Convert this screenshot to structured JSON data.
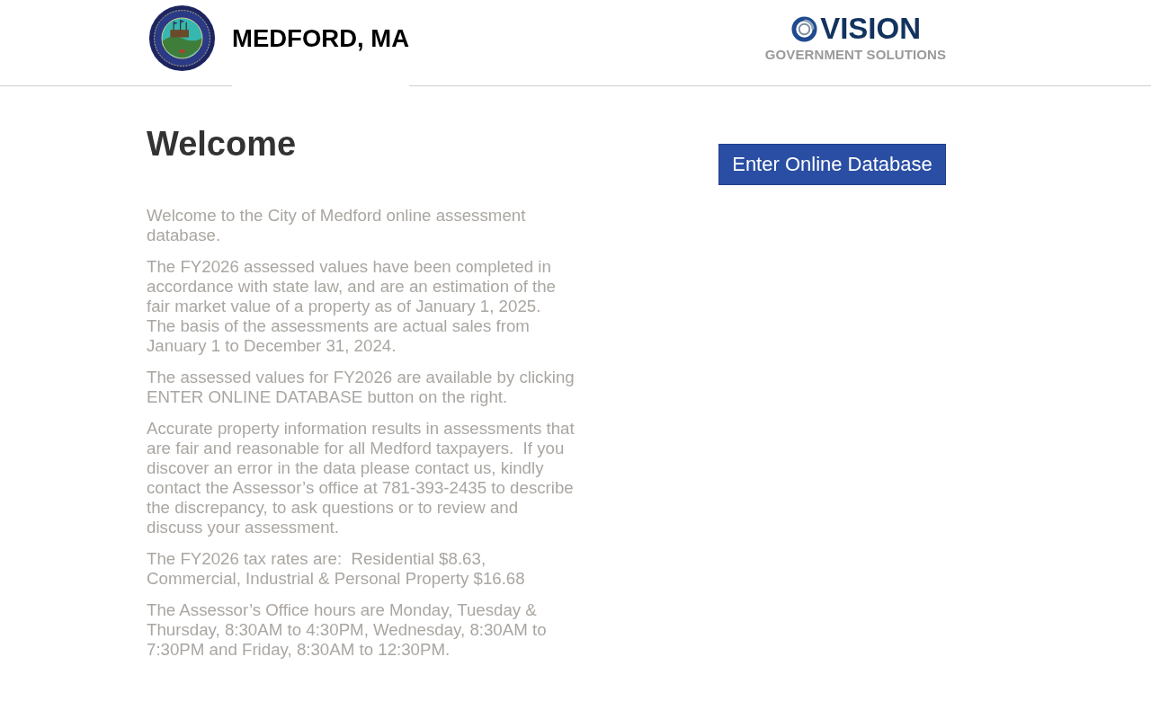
{
  "header": {
    "city_title": "MEDFORD, MA",
    "vendor_logo": {
      "wordmark": "VISION",
      "tagline": "GOVERNMENT SOLUTIONS"
    }
  },
  "welcome": {
    "title": "Welcome",
    "paragraphs": [
      "Welcome to the City of Medford online assessment database.",
      "The FY2026 assessed values have been completed in accordance with state law, and are an estimation of the fair market value of a property as of January 1, 2025.  The basis of the assessments are actual sales from January 1 to December 31, 2024.",
      "The assessed values for FY2026 are available by clicking ENTER ONLINE DATABASE button on the right.",
      "Accurate property information results in assessments that are fair and reasonable for all Medford taxpayers.  If you discover an error in the data please contact us, kindly contact the Assessor’s office at 781-393-2435 to describe the discrepancy, to ask questions or to review and discuss your assessment.",
      "The FY2026 tax rates are:  Residential $8.63, Commercial, Industrial & Personal Property $16.68",
      "The Assessor’s Office hours are Monday, Tuesday & Thursday, 8:30AM to 4:30PM, Wednesday, 8:30AM to 7:30PM and Friday, 8:30AM to 12:30PM."
    ]
  },
  "enter_button": {
    "label": "Enter Online Database"
  }
}
